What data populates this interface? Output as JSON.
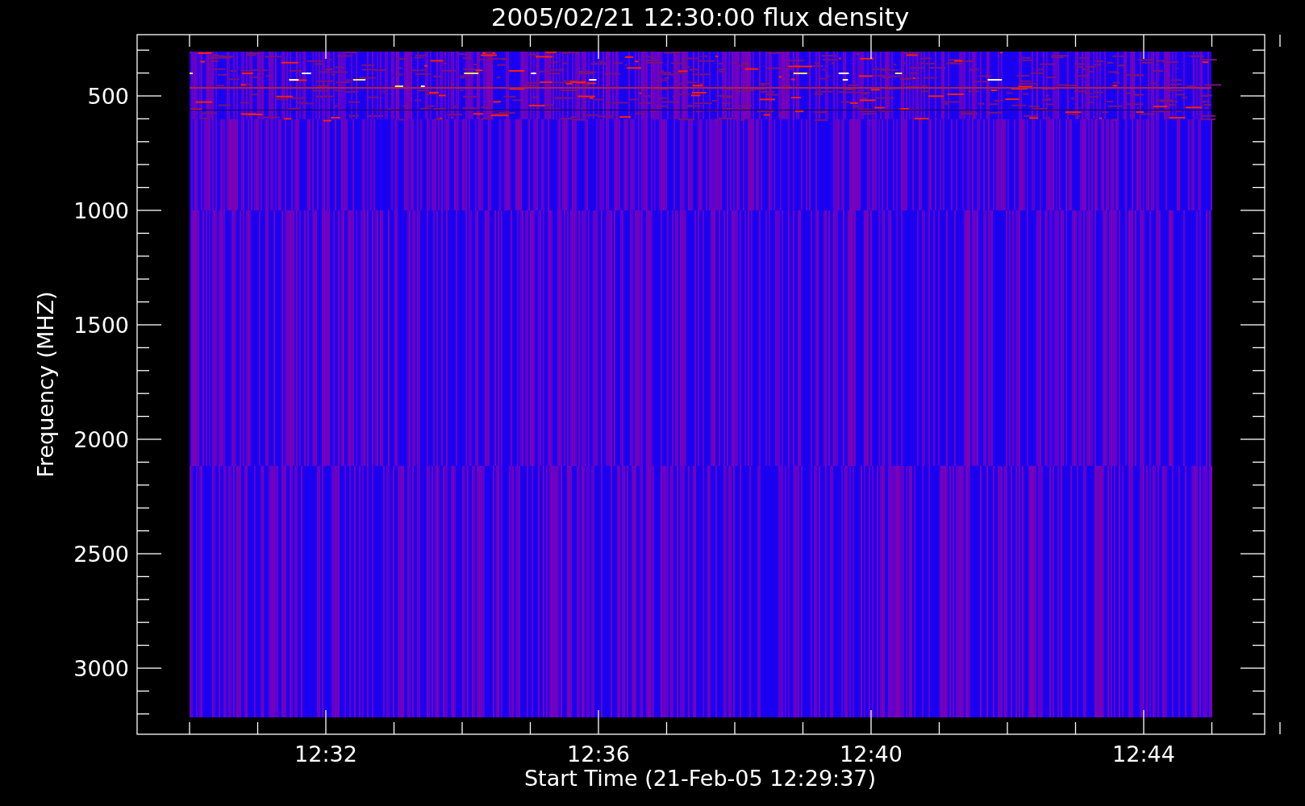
{
  "plot": {
    "title": "2005/02/21 12:30:00 flux density",
    "xlabel": "Start Time (21-Feb-05 12:29:37)",
    "ylabel": "Frequency (MHZ)",
    "yticks": [
      "500",
      "1000",
      "1500",
      "2000",
      "2500",
      "3000"
    ],
    "xticks": [
      "12:32",
      "12:36",
      "12:40",
      "12:44"
    ]
  }
}
